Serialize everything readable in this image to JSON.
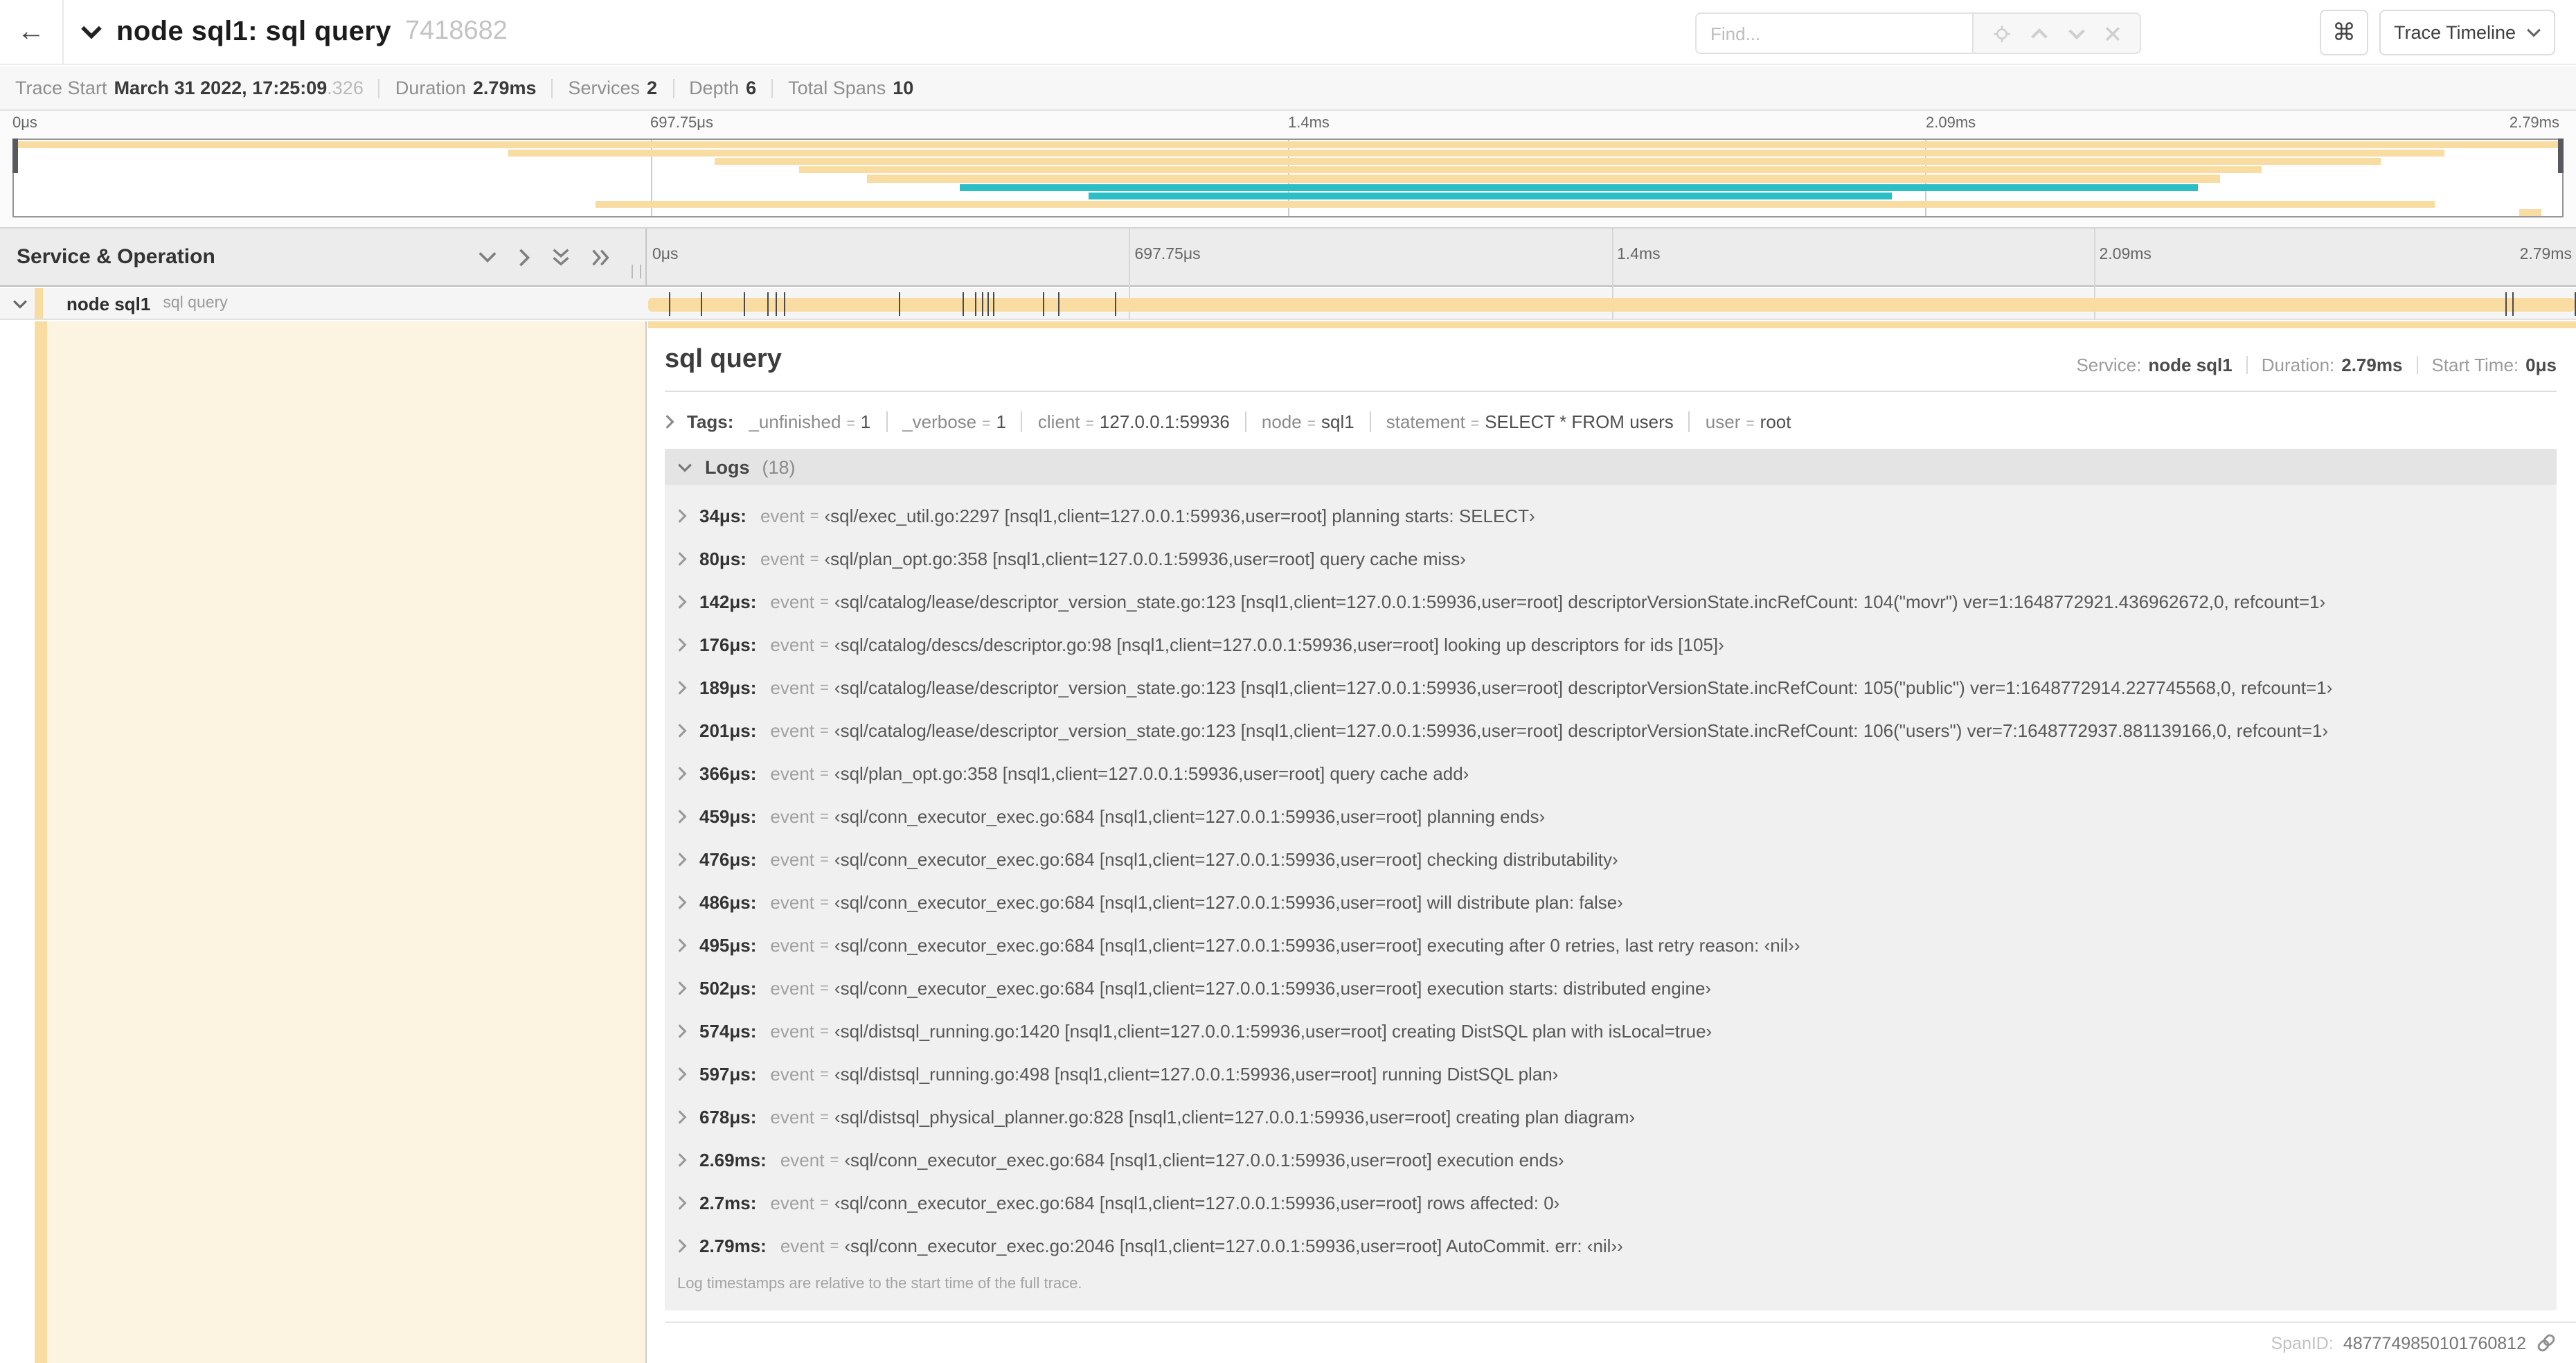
{
  "colors": {
    "tan": "#f8dca1",
    "teal": "#2abfc4",
    "accent_strip": "#f8dca1"
  },
  "duration_us": 2790,
  "header": {
    "back_label": "←",
    "title": "node sql1: sql query",
    "trace_id": "7418682",
    "find_placeholder": "Find...",
    "shortcut_label": "⌘",
    "view_button": "Trace Timeline"
  },
  "trace_info": {
    "items": [
      {
        "label": "Trace Start",
        "value": "March 31 2022, 17:25:09",
        "suffix": ".326"
      },
      {
        "label": "Duration",
        "value": "2.79ms"
      },
      {
        "label": "Services",
        "value": "2"
      },
      {
        "label": "Depth",
        "value": "6"
      },
      {
        "label": "Total Spans",
        "value": "10"
      }
    ]
  },
  "ruler_ticks": [
    "0μs",
    "697.75μs",
    "1.4ms",
    "2.09ms",
    "2.79ms"
  ],
  "minimap": {
    "spans": [
      {
        "start_pct": 0,
        "end_pct": 100,
        "color": "tan"
      },
      {
        "start_pct": 19.4,
        "end_pct": 95.4,
        "color": "tan"
      },
      {
        "start_pct": 27.5,
        "end_pct": 92.9,
        "color": "tan"
      },
      {
        "start_pct": 30.8,
        "end_pct": 88.2,
        "color": "tan"
      },
      {
        "start_pct": 33.5,
        "end_pct": 86.6,
        "color": "tan"
      },
      {
        "start_pct": 37.1,
        "end_pct": 85.7,
        "color": "teal"
      },
      {
        "start_pct": 42.2,
        "end_pct": 73.7,
        "color": "teal"
      },
      {
        "start_pct": 22.8,
        "end_pct": 95.0,
        "color": "tan"
      },
      {
        "start_pct": 98.3,
        "end_pct": 99.2,
        "color": "tan"
      }
    ]
  },
  "span_tree": {
    "header": "Service & Operation",
    "row": {
      "service": "node sql1",
      "operation": "sql query"
    }
  },
  "detail": {
    "title": "sql query",
    "service_label": "Service:",
    "service": "node sql1",
    "duration_label": "Duration:",
    "duration": "2.79ms",
    "start_label": "Start Time:",
    "start": "0μs",
    "tags_label": "Tags:",
    "tags": [
      {
        "key": "_unfinished",
        "value": "1"
      },
      {
        "key": "_verbose",
        "value": "1"
      },
      {
        "key": "client",
        "value": "127.0.0.1:59936"
      },
      {
        "key": "node",
        "value": "sql1"
      },
      {
        "key": "statement",
        "value": "SELECT * FROM users"
      },
      {
        "key": "user",
        "value": "root"
      }
    ],
    "logs_label": "Logs",
    "logs_count": "(18)",
    "logs": [
      {
        "time": "34μs:",
        "t_us": 34,
        "key": "event",
        "value": "‹sql/exec_util.go:2297 [nsql1,client=127.0.0.1:59936,user=root] planning starts: SELECT›"
      },
      {
        "time": "80μs:",
        "t_us": 80,
        "key": "event",
        "value": "‹sql/plan_opt.go:358 [nsql1,client=127.0.0.1:59936,user=root] query cache miss›"
      },
      {
        "time": "142μs:",
        "t_us": 142,
        "key": "event",
        "value": "‹sql/catalog/lease/descriptor_version_state.go:123 [nsql1,client=127.0.0.1:59936,user=root] descriptorVersionState.incRefCount: 104(\"movr\") ver=1:1648772921.436962672,0, refcount=1›"
      },
      {
        "time": "176μs:",
        "t_us": 176,
        "key": "event",
        "value": "‹sql/catalog/descs/descriptor.go:98 [nsql1,client=127.0.0.1:59936,user=root] looking up descriptors for ids [105]›"
      },
      {
        "time": "189μs:",
        "t_us": 189,
        "key": "event",
        "value": "‹sql/catalog/lease/descriptor_version_state.go:123 [nsql1,client=127.0.0.1:59936,user=root] descriptorVersionState.incRefCount: 105(\"public\") ver=1:1648772914.227745568,0, refcount=1›"
      },
      {
        "time": "201μs:",
        "t_us": 201,
        "key": "event",
        "value": "‹sql/catalog/lease/descriptor_version_state.go:123 [nsql1,client=127.0.0.1:59936,user=root] descriptorVersionState.incRefCount: 106(\"users\") ver=7:1648772937.881139166,0, refcount=1›"
      },
      {
        "time": "366μs:",
        "t_us": 366,
        "key": "event",
        "value": "‹sql/plan_opt.go:358 [nsql1,client=127.0.0.1:59936,user=root] query cache add›"
      },
      {
        "time": "459μs:",
        "t_us": 459,
        "key": "event",
        "value": "‹sql/conn_executor_exec.go:684 [nsql1,client=127.0.0.1:59936,user=root] planning ends›"
      },
      {
        "time": "476μs:",
        "t_us": 476,
        "key": "event",
        "value": "‹sql/conn_executor_exec.go:684 [nsql1,client=127.0.0.1:59936,user=root] checking distributability›"
      },
      {
        "time": "486μs:",
        "t_us": 486,
        "key": "event",
        "value": "‹sql/conn_executor_exec.go:684 [nsql1,client=127.0.0.1:59936,user=root] will distribute plan: false›"
      },
      {
        "time": "495μs:",
        "t_us": 495,
        "key": "event",
        "value": "‹sql/conn_executor_exec.go:684 [nsql1,client=127.0.0.1:59936,user=root] executing after 0 retries, last retry reason: ‹nil››"
      },
      {
        "time": "502μs:",
        "t_us": 502,
        "key": "event",
        "value": "‹sql/conn_executor_exec.go:684 [nsql1,client=127.0.0.1:59936,user=root] execution starts: distributed engine›"
      },
      {
        "time": "574μs:",
        "t_us": 574,
        "key": "event",
        "value": "‹sql/distsql_running.go:1420 [nsql1,client=127.0.0.1:59936,user=root] creating DistSQL plan with isLocal=true›"
      },
      {
        "time": "597μs:",
        "t_us": 597,
        "key": "event",
        "value": "‹sql/distsql_running.go:498 [nsql1,client=127.0.0.1:59936,user=root] running DistSQL plan›"
      },
      {
        "time": "678μs:",
        "t_us": 678,
        "key": "event",
        "value": "‹sql/distsql_physical_planner.go:828 [nsql1,client=127.0.0.1:59936,user=root] creating plan diagram›"
      },
      {
        "time": "2.69ms:",
        "t_us": 2690,
        "key": "event",
        "value": "‹sql/conn_executor_exec.go:684 [nsql1,client=127.0.0.1:59936,user=root] execution ends›"
      },
      {
        "time": "2.7ms:",
        "t_us": 2700,
        "key": "event",
        "value": "‹sql/conn_executor_exec.go:684 [nsql1,client=127.0.0.1:59936,user=root] rows affected: 0›"
      },
      {
        "time": "2.79ms:",
        "t_us": 2790,
        "key": "event",
        "value": "‹sql/conn_executor_exec.go:2046 [nsql1,client=127.0.0.1:59936,user=root] AutoCommit. err: ‹nil››"
      }
    ],
    "footer_note": "Log timestamps are relative to the start time of the full trace.",
    "span_id_label": "SpanID:",
    "span_id": "4877749850101760812"
  }
}
